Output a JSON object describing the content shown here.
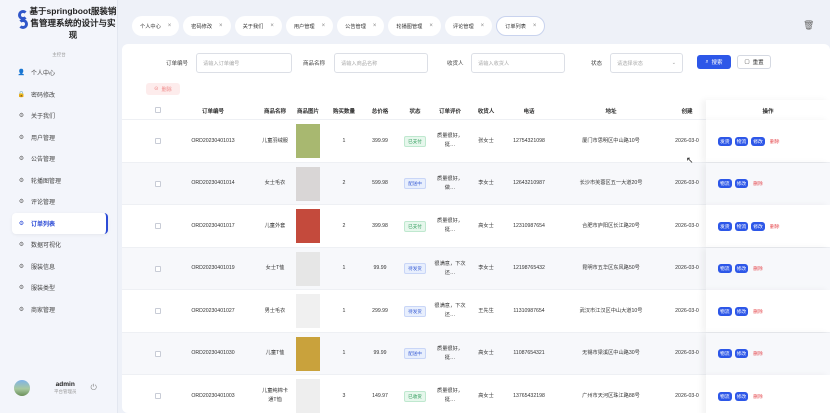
{
  "app": {
    "title": "基于springboot服装销售管理系统的设计与实现",
    "menu_caption": "主控台",
    "user_name": "admin",
    "user_role": "平台管理员"
  },
  "sidebar": {
    "items": [
      {
        "label": "个人中心",
        "icon": "user-icon",
        "active": false
      },
      {
        "label": "密码修改",
        "icon": "lock-icon",
        "active": false
      },
      {
        "label": "关于我们",
        "icon": "gear-icon",
        "active": false
      },
      {
        "label": "用户管理",
        "icon": "gear-icon",
        "active": false
      },
      {
        "label": "公告管理",
        "icon": "gear-icon",
        "active": false
      },
      {
        "label": "轮播图管理",
        "icon": "gear-icon",
        "active": false
      },
      {
        "label": "评论管理",
        "icon": "gear-icon",
        "active": false
      },
      {
        "label": "订单列表",
        "icon": "gear-icon",
        "active": true
      },
      {
        "label": "数据可视化",
        "icon": "gear-icon",
        "active": false
      },
      {
        "label": "服装信息",
        "icon": "gear-icon",
        "active": false
      },
      {
        "label": "服装类型",
        "icon": "gear-icon",
        "active": false
      },
      {
        "label": "商家管理",
        "icon": "gear-icon",
        "active": false
      }
    ]
  },
  "tabs": [
    {
      "label": "个人中心",
      "active": false
    },
    {
      "label": "密码修改",
      "active": false
    },
    {
      "label": "关于我们",
      "active": false
    },
    {
      "label": "用户管理",
      "active": false
    },
    {
      "label": "公告管理",
      "active": false
    },
    {
      "label": "轮播图管理",
      "active": false
    },
    {
      "label": "评论管理",
      "active": false
    },
    {
      "label": "订单列表",
      "active": true
    }
  ],
  "search": {
    "order_no_label": "订单编号",
    "order_no_placeholder": "请输入订单编号",
    "product_label": "商品名称",
    "product_placeholder": "请输入商品名称",
    "receiver_label": "收货人",
    "receiver_placeholder": "请输入收货人",
    "status_label": "状态",
    "status_placeholder": "请选择状态",
    "search_button": "搜索",
    "reset_button": "重置",
    "delete_button": "删除"
  },
  "table": {
    "headers": [
      "订单编号",
      "商品名称",
      "商品图片",
      "购买数量",
      "总价格",
      "状态",
      "订单评价",
      "收货人",
      "电话",
      "地址",
      "创建",
      "操作"
    ],
    "rows": [
      {
        "order_no": "ORD20230401013",
        "product": "儿童羽绒服",
        "qty": "1",
        "total": "399.99",
        "status": "已支付",
        "status_color": "green",
        "review": "质量很好，挺…",
        "receiver": "张女士",
        "phone": "12754321098",
        "address": "厦门市思明区中山路10号",
        "created": "2026-03-0",
        "ops": [
          "发货",
          "物流",
          "修改",
          "删除"
        ],
        "thumb_bg": "#a8b870"
      },
      {
        "order_no": "ORD20230401014",
        "product": "女士毛衣",
        "qty": "2",
        "total": "599.98",
        "status": "配送中",
        "status_color": "blue",
        "review": "质量很好，做…",
        "receiver": "李女士",
        "phone": "12643210987",
        "address": "长沙市芙蓉区五一大道20号",
        "created": "2026-03-0",
        "ops": [
          "物流",
          "修改",
          "删除"
        ],
        "thumb_bg": "#d9d6d6"
      },
      {
        "order_no": "ORD20230401017",
        "product": "儿童外套",
        "qty": "2",
        "total": "399.98",
        "status": "已支付",
        "status_color": "green",
        "review": "质量很好，挺…",
        "receiver": "高女士",
        "phone": "12310987654",
        "address": "合肥市庐阳区长江路20号",
        "created": "2026-03-0",
        "ops": [
          "发货",
          "物流",
          "修改",
          "删除"
        ],
        "thumb_bg": "#c44a3c"
      },
      {
        "order_no": "ORD20230401019",
        "product": "女士T恤",
        "qty": "1",
        "total": "99.99",
        "status": "待发货",
        "status_color": "blue",
        "review": "很满意，下次还…",
        "receiver": "李女士",
        "phone": "12198765432",
        "address": "昆明市五华区东风路50号",
        "created": "2026-03-0",
        "ops": [
          "物流",
          "修改",
          "删除"
        ],
        "thumb_bg": "#e6e6e6"
      },
      {
        "order_no": "ORD20230401027",
        "product": "男士毛衣",
        "qty": "1",
        "total": "299.99",
        "status": "待发货",
        "status_color": "blue",
        "review": "很满意，下次还…",
        "receiver": "王先生",
        "phone": "11310987654",
        "address": "武汉市江汉区中山大道10号",
        "created": "2026-03-0",
        "ops": [
          "物流",
          "修改",
          "删除"
        ],
        "thumb_bg": "#f0f0f0"
      },
      {
        "order_no": "ORD20230401030",
        "product": "儿童T恤",
        "qty": "1",
        "total": "99.99",
        "status": "配送中",
        "status_color": "blue",
        "review": "质量很好，挺…",
        "receiver": "高女士",
        "phone": "11087654321",
        "address": "无锡市梁溪区中山路30号",
        "created": "2026-03-0",
        "ops": [
          "物流",
          "修改",
          "删除"
        ],
        "thumb_bg": "#c9a23c"
      },
      {
        "order_no": "ORD20230401003",
        "product": "儿童纯棉卡通T恤",
        "qty": "3",
        "total": "149.97",
        "status": "已收货",
        "status_color": "green",
        "review": "质量很好，挺…",
        "receiver": "高女士",
        "phone": "13765432198",
        "address": "广州市天河区珠江路88号",
        "created": "2026-03-0",
        "ops": [
          "物流",
          "修改",
          "删除"
        ],
        "thumb_bg": "#eeeeee"
      }
    ]
  }
}
